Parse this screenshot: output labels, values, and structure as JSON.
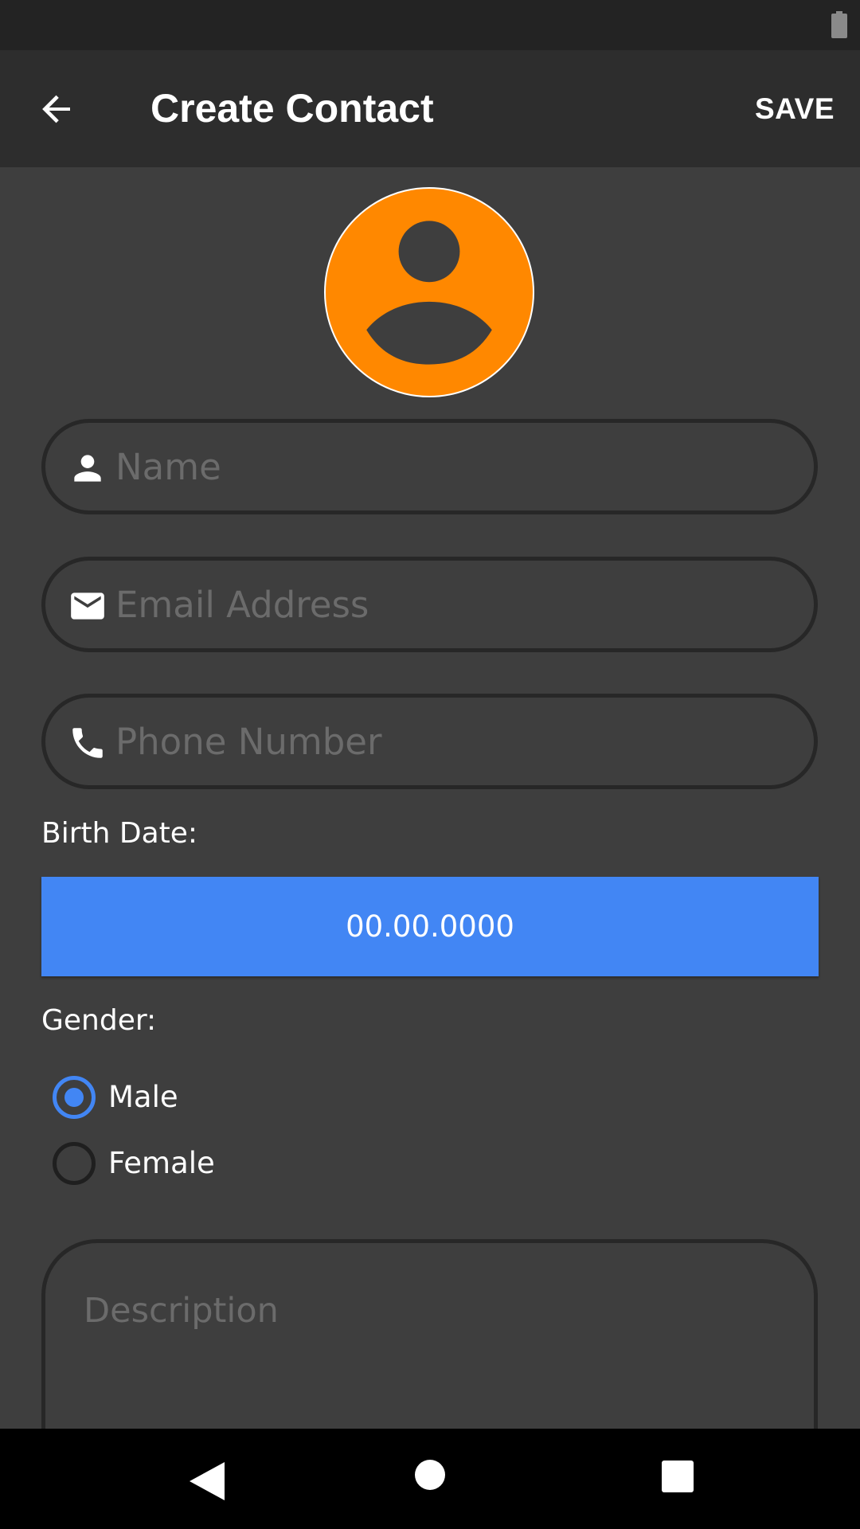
{
  "app_bar": {
    "title": "Create Contact",
    "save_label": "SAVE"
  },
  "avatar": {
    "icon": "account-circle-icon",
    "color": "#ff8800"
  },
  "fields": {
    "name": {
      "placeholder": "Name",
      "value": "",
      "icon": "person-icon"
    },
    "email": {
      "placeholder": "Email Address",
      "value": "",
      "icon": "mail-icon"
    },
    "phone": {
      "placeholder": "Phone Number",
      "value": "",
      "icon": "phone-icon"
    }
  },
  "birth_date": {
    "label": "Birth Date:",
    "value": "00.00.0000",
    "button_color": "#4286f4"
  },
  "gender": {
    "label": "Gender:",
    "options": [
      {
        "label": "Male",
        "checked": true
      },
      {
        "label": "Female",
        "checked": false
      }
    ]
  },
  "description": {
    "placeholder": "Description",
    "value": ""
  },
  "colors": {
    "background": "#3e3e3e",
    "app_bar": "#2d2d2d",
    "status_bar": "#232323",
    "accent": "#4286f4"
  }
}
